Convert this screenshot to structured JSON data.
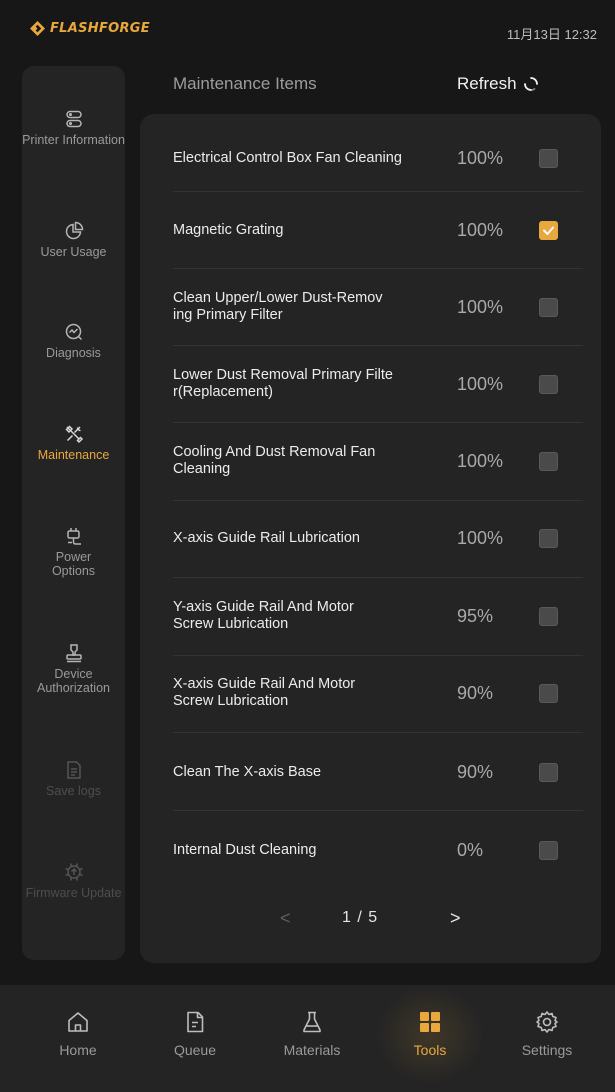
{
  "status_bar": {
    "brand": "FLASHFORGE",
    "clock": "11月13日 12:32"
  },
  "colors": {
    "accent": "#e8a83e",
    "background": "#171717",
    "panel": "#242424"
  },
  "sidebar": {
    "items": [
      {
        "label": "Printer Information",
        "icon": "printer-info-icon",
        "state": "normal"
      },
      {
        "label": "User Usage",
        "icon": "pie-chart-icon",
        "state": "normal"
      },
      {
        "label": "Diagnosis",
        "icon": "diagnosis-icon",
        "state": "normal"
      },
      {
        "label": "Maintenance",
        "icon": "wrench-screwdriver-icon",
        "state": "active"
      },
      {
        "label": "Power Options",
        "icon": "plug-icon",
        "state": "normal"
      },
      {
        "label": "Device Authorization",
        "icon": "stamp-icon",
        "state": "normal"
      },
      {
        "label": "Save logs",
        "icon": "document-icon",
        "state": "disabled"
      },
      {
        "label": "Firmware Update",
        "icon": "firmware-update-icon",
        "state": "disabled"
      }
    ]
  },
  "header": {
    "title": "Maintenance Items",
    "refresh_label": "Refresh"
  },
  "maintenance_items": [
    {
      "name": "Electrical Control Box Fan Cleaning",
      "percent": "100%",
      "checked": false
    },
    {
      "name": "Magnetic Grating",
      "percent": "100%",
      "checked": true
    },
    {
      "name": "Clean Upper/Lower Dust-Remov\ning Primary Filter",
      "percent": "100%",
      "checked": false
    },
    {
      "name": "Lower Dust Removal Primary Filte\nr(Replacement)",
      "percent": "100%",
      "checked": false
    },
    {
      "name": "Cooling And Dust Removal Fan\nCleaning",
      "percent": "100%",
      "checked": false
    },
    {
      "name": "X-axis Guide Rail Lubrication",
      "percent": "100%",
      "checked": false
    },
    {
      "name": "Y-axis Guide Rail And Motor\n Screw Lubrication",
      "percent": "95%",
      "checked": false
    },
    {
      "name": "X-axis Guide Rail And Motor\n Screw Lubrication",
      "percent": "90%",
      "checked": false
    },
    {
      "name": "Clean The X-axis Base",
      "percent": "90%",
      "checked": false
    },
    {
      "name": "Internal Dust Cleaning",
      "percent": "0%",
      "checked": false
    }
  ],
  "pagination": {
    "prev": "<",
    "next": ">",
    "text": "1 / 5"
  },
  "bottom_nav": [
    {
      "label": "Home",
      "icon": "home-icon",
      "active": false
    },
    {
      "label": "Queue",
      "icon": "queue-document-icon",
      "active": false
    },
    {
      "label": "Materials",
      "icon": "flask-icon",
      "active": false
    },
    {
      "label": "Tools",
      "icon": "tools-grid-icon",
      "active": true
    },
    {
      "label": "Settings",
      "icon": "gear-icon",
      "active": false
    }
  ]
}
